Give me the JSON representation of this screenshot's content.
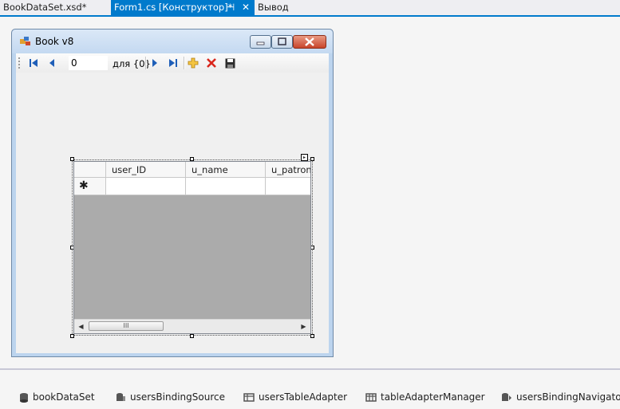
{
  "tabs": [
    {
      "label": "BookDataSet.xsd*",
      "active": false
    },
    {
      "label": "Form1.cs [Конструктор]*",
      "active": true,
      "pin_glyph": "⊣",
      "close_glyph": "✕"
    },
    {
      "label": "Вывод",
      "active": false
    }
  ],
  "form": {
    "title": "Book v8",
    "icon": "form-app-icon"
  },
  "navigator": {
    "position_value": "0",
    "count_label": "для {0}",
    "buttons": [
      "move-first-icon",
      "move-previous-icon",
      "move-next-icon",
      "move-last-icon",
      "add-new-icon",
      "delete-icon",
      "save-icon"
    ]
  },
  "grid": {
    "columns": [
      "user_ID",
      "u_name",
      "u_patronymic"
    ],
    "new_row_glyph": "✱",
    "scroll_thumb_glyph": "III",
    "scroll_left_glyph": "◀",
    "scroll_right_glyph": "▶",
    "smart_tag_glyph": "▸"
  },
  "tray": {
    "items": [
      {
        "label": "bookDataSet",
        "icon": "dataset-icon"
      },
      {
        "label": "usersBindingSource",
        "icon": "binding-source-icon"
      },
      {
        "label": "usersTableAdapter",
        "icon": "table-adapter-icon"
      },
      {
        "label": "tableAdapterManager",
        "icon": "adapter-manager-icon"
      },
      {
        "label": "usersBindingNavigator",
        "icon": "binding-navigator-icon"
      }
    ]
  },
  "colors": {
    "accent": "#007acc",
    "grid_background": "#ababab"
  }
}
